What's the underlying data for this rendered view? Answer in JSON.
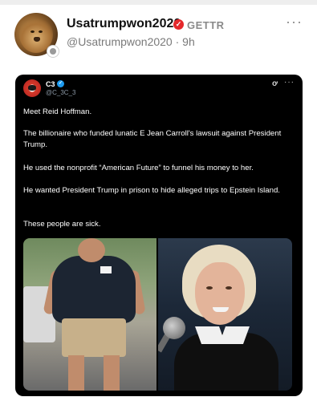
{
  "post": {
    "display_name": "Usatrumpwon2020",
    "platform_label": "GETTR",
    "handle_time": "@Usatrumpwon2020 · 9h",
    "more_label": "···"
  },
  "embed": {
    "author_name": "C3",
    "author_handle": "@C_3C_3",
    "more_label": "···",
    "icon_label": "ơ",
    "paragraphs": [
      "Meet Reid Hoffman.",
      "The billionaire who funded lunatic E Jean Carroll's lawsuit against President Trump.",
      "He used the nonprofit “American Future” to funnel his money to her.",
      "He wanted President Trump in prison to hide alleged trips to Epstein Island.",
      "These people are sick."
    ]
  },
  "colors": {
    "verified_red": "#e5282b",
    "verified_blue": "#1d9bf0",
    "embed_bg": "#000000"
  },
  "icons": {
    "verified_badge": "verified-badge-icon",
    "more": "more-icon",
    "embed_verified": "verified-check-icon"
  }
}
